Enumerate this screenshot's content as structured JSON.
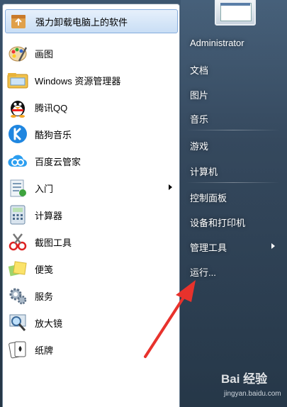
{
  "programs": [
    {
      "label": "强力卸载电脑上的软件",
      "icon": "uninstall-icon",
      "selected": true
    },
    {
      "label": "画图",
      "icon": "paint-icon"
    },
    {
      "label": "Windows 资源管理器",
      "icon": "explorer-icon"
    },
    {
      "label": "腾讯QQ",
      "icon": "qq-icon"
    },
    {
      "label": "酷狗音乐",
      "icon": "kugou-icon"
    },
    {
      "label": "百度云管家",
      "icon": "baidu-cloud-icon"
    },
    {
      "label": "入门",
      "icon": "getting-started-icon",
      "submenu": true
    },
    {
      "label": "计算器",
      "icon": "calculator-icon"
    },
    {
      "label": "截图工具",
      "icon": "snipping-tool-icon"
    },
    {
      "label": "便笺",
      "icon": "sticky-notes-icon"
    },
    {
      "label": "服务",
      "icon": "services-icon"
    },
    {
      "label": "放大镜",
      "icon": "magnifier-icon"
    },
    {
      "label": "纸牌",
      "icon": "solitaire-icon"
    }
  ],
  "right_pane": {
    "user": "Administrator",
    "items": [
      {
        "label": "文档"
      },
      {
        "label": "图片"
      },
      {
        "label": "音乐"
      },
      {
        "label": "游戏"
      },
      {
        "label": "计算机"
      },
      {
        "label": "控制面板"
      },
      {
        "label": "设备和打印机"
      },
      {
        "label": "管理工具",
        "submenu": true
      },
      {
        "label": "运行..."
      }
    ]
  },
  "annotation": {
    "color": "#e8322c"
  },
  "watermark": {
    "logo": "Bai 经验",
    "url": "jingyan.baidu.com"
  }
}
